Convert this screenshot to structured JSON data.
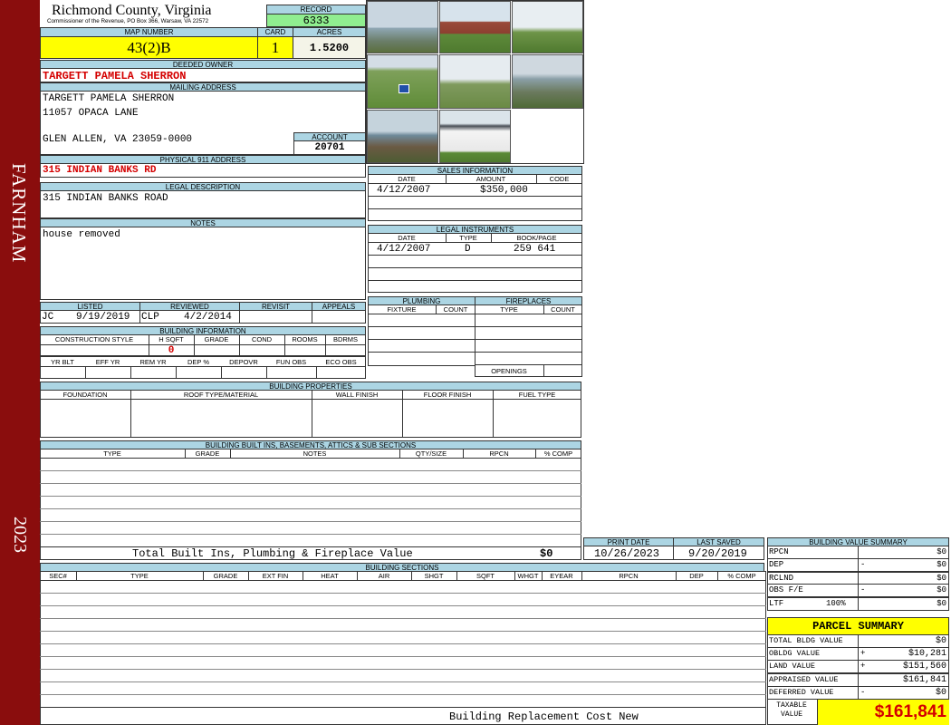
{
  "county": {
    "name": "Richmond County, Virginia",
    "address": "Commissioner of the Revenue, PO Box 366, Warsaw, VA 22572"
  },
  "side": {
    "district": "FARNHAM",
    "year": "2023"
  },
  "record": {
    "label": "RECORD",
    "value": "6333"
  },
  "map": {
    "label": "MAP NUMBER",
    "value": "43(2)B"
  },
  "card": {
    "label": "CARD",
    "value": "1"
  },
  "acres": {
    "label": "ACRES",
    "value": "1.5200"
  },
  "deeded_owner": {
    "label": "DEEDED OWNER",
    "value": "TARGETT PAMELA SHERRON"
  },
  "mailing": {
    "label": "MAILING ADDRESS",
    "line1": "TARGETT PAMELA SHERRON",
    "line2": "11057 OPACA LANE",
    "line3": "GLEN ALLEN, VA 23059-0000"
  },
  "account": {
    "label": "ACCOUNT",
    "value": "20701"
  },
  "physical": {
    "label": "PHYSICAL 911 ADDRESS",
    "value": "315 INDIAN BANKS RD"
  },
  "legal": {
    "label": "LEGAL DESCRIPTION",
    "value": "315 INDIAN BANKS ROAD"
  },
  "notes": {
    "label": "NOTES",
    "value": "house removed"
  },
  "listing": {
    "listed_label": "LISTED",
    "listed_by": "JC",
    "listed_date": "9/19/2019",
    "reviewed_label": "REVIEWED",
    "reviewed_by": "CLP",
    "reviewed_date": "4/2/2014",
    "revisit_label": "REVISIT",
    "appeals_label": "APPEALS"
  },
  "building_info": {
    "label": "BUILDING INFORMATION",
    "cols": [
      "CONSTRUCTION STYLE",
      "H SQFT",
      "GRADE",
      "COND",
      "ROOMS",
      "BDRMS"
    ],
    "hsqft": "0",
    "cols2": [
      "YR BLT",
      "EFF YR",
      "REM YR",
      "DEP %",
      "DEPOVR",
      "FUN OBS",
      "ECO OBS"
    ]
  },
  "sales": {
    "label": "SALES INFORMATION",
    "cols": [
      "DATE",
      "AMOUNT",
      "CODE"
    ],
    "date": "4/12/2007",
    "amount": "$350,000"
  },
  "instruments": {
    "label": "LEGAL INSTRUMENTS",
    "cols": [
      "DATE",
      "TYPE",
      "BOOK/PAGE"
    ],
    "date": "4/12/2007",
    "type": "D",
    "bookpage": "259 641"
  },
  "plumbing": {
    "label": "PLUMBING",
    "cols": [
      "FIXTURE",
      "COUNT"
    ]
  },
  "fireplaces": {
    "label": "FIREPLACES",
    "cols": [
      "TYPE",
      "COUNT"
    ],
    "openings": "OPENINGS"
  },
  "properties": {
    "label": "BUILDING PROPERTIES",
    "cols": [
      "FOUNDATION",
      "ROOF TYPE/MATERIAL",
      "WALL FINISH",
      "FLOOR FINISH",
      "FUEL TYPE"
    ]
  },
  "builtins": {
    "label": "BUILDING BUILT INS, BASEMENTS, ATTICS & SUB SECTIONS",
    "cols": [
      "TYPE",
      "GRADE",
      "NOTES",
      "QTY/SIZE",
      "RPCN",
      "% COMP"
    ],
    "total_label": "Total Built Ins, Plumbing & Fireplace Value",
    "total_value": "$0"
  },
  "print": {
    "print_label": "PRINT DATE",
    "print_date": "10/26/2023",
    "saved_label": "LAST SAVED",
    "saved_date": "9/20/2019"
  },
  "sections": {
    "label": "BUILDING SECTIONS",
    "cols": [
      "SEC#",
      "TYPE",
      "GRADE",
      "EXT FIN",
      "HEAT",
      "AIR",
      "SHGT",
      "SQFT",
      "WHGT",
      "EYEAR",
      "RPCN",
      "DEP",
      "% COMP"
    ],
    "footer": "Building Replacement Cost New"
  },
  "bvs": {
    "label": "BUILDING VALUE SUMMARY",
    "rows": [
      {
        "label": "RPCN",
        "sign": "",
        "value": "$0"
      },
      {
        "label": "DEP",
        "sign": "-",
        "value": "$0"
      },
      {
        "label": "RCLND",
        "sign": "",
        "value": "$0"
      },
      {
        "label": "OBS F/E",
        "sign": "-",
        "value": "$0"
      },
      {
        "label": "LTF",
        "pct": "100%",
        "sign": "",
        "value": "$0"
      }
    ]
  },
  "parcel": {
    "label": "PARCEL SUMMARY",
    "rows": [
      {
        "label": "TOTAL BLDG VALUE",
        "sign": "",
        "value": "$0"
      },
      {
        "label": "OBLDG VALUE",
        "sign": "+",
        "value": "$10,281"
      },
      {
        "label": "LAND VALUE",
        "sign": "+",
        "value": "$151,560"
      },
      {
        "label": "APPRAISED VALUE",
        "sign": "",
        "value": "$161,841"
      },
      {
        "label": "DEFERRED VALUE",
        "sign": "-",
        "value": "$0"
      }
    ],
    "taxable_label": "TAXABLE VALUE",
    "taxable_value": "$161,841"
  },
  "colors": {
    "header_bg": "#acd5e3",
    "highlight": "#ffff00",
    "record_bg": "#90ee90",
    "sidebar": "#8a0d0d",
    "red_text": "#d40000"
  },
  "photos": [
    "waterfront-pier",
    "brick-outbuilding",
    "lawn-shed",
    "lawn-with-sign",
    "field-with-pole",
    "pier-boathouse",
    "dock-walkway",
    "white-shed"
  ]
}
